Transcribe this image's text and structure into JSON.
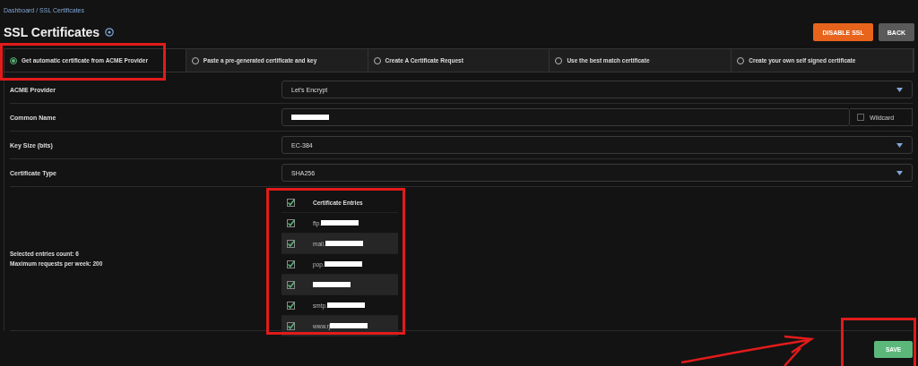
{
  "breadcrumb": "Dashboard / SSL Certificates",
  "title": "SSL Certificates",
  "header_buttons": [
    {
      "label": "DISABLE SSL",
      "kind": "danger"
    },
    {
      "label": "BACK",
      "kind": "secondary"
    }
  ],
  "tabs": [
    {
      "label": "Get automatic certificate from ACME Provider",
      "selected": true,
      "highlighted": true
    },
    {
      "label": "Paste a pre-generated certificate and key",
      "selected": false,
      "highlighted": false
    },
    {
      "label": "Create A Certificate Request",
      "selected": false,
      "highlighted": false
    },
    {
      "label": "Use the best match certificate",
      "selected": false,
      "highlighted": false
    },
    {
      "label": "Create your own self signed certificate",
      "selected": false,
      "highlighted": false
    }
  ],
  "fields": [
    {
      "label": "ACME Provider",
      "kind": "select",
      "value": "Let's Encrypt"
    },
    {
      "label": "Common Name",
      "kind": "text",
      "redacted": true,
      "checkbox": {
        "label": "Wildcard",
        "checked": false
      }
    },
    {
      "label": "Key Size (bits)",
      "kind": "select",
      "value": "EC-384"
    },
    {
      "label": "Certificate Type",
      "kind": "select",
      "value": "SHA256"
    }
  ],
  "entries": {
    "highlighted": true,
    "stats": [
      "Selected entries count: 6",
      "Maximum requests per week: 200"
    ],
    "header": {
      "label": "Certificate Entries",
      "checked": true
    },
    "items": [
      {
        "text": "ftp.",
        "redacted": true,
        "checked": true
      },
      {
        "text": "mail.",
        "redacted": true,
        "checked": true
      },
      {
        "text": "pop.",
        "redacted": true,
        "checked": true
      },
      {
        "redacted": true,
        "checked": true
      },
      {
        "text": "smtp.",
        "redacted": true,
        "checked": true
      },
      {
        "text": "www.rj",
        "redacted": true,
        "checked": true
      }
    ]
  },
  "save_button": {
    "label": "SAVE",
    "highlighted": true
  }
}
